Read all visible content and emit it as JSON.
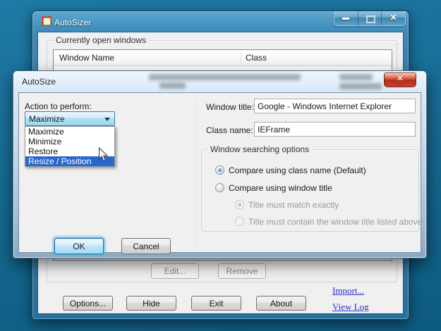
{
  "colors": {
    "desktop_top": "#1e7aa6",
    "desktop_bottom": "#0d5a80",
    "titlebar_blue": "#2e7dab",
    "selection_blue": "#2767ce",
    "close_button_red": "#c4452c",
    "link_blue": "#2430cf"
  },
  "main_window": {
    "title": "AutoSizer",
    "caption_buttons": [
      "minimize",
      "maximize",
      "close"
    ],
    "close_glyph": "✕",
    "open_windows_group": {
      "label": "Currently open windows",
      "columns": [
        "Window Name",
        "Class"
      ]
    },
    "edit_button": "Edit...",
    "remove_button": "Remove",
    "options_button": "Options...",
    "hide_button": "Hide",
    "exit_button": "Exit",
    "about_button": "About",
    "import_link": "Import...",
    "view_log_link": "View Log"
  },
  "dialog": {
    "title": "AutoSize",
    "close_glyph": "✕",
    "action_label": "Action to perform:",
    "action_value": "Maximize",
    "dropdown": {
      "items": [
        "Maximize",
        "Minimize",
        "Restore",
        "Resize / Position"
      ],
      "highlighted": "Resize / Position"
    },
    "window_title_label": "Window title:",
    "window_title_value": "Google - Windows Internet Explorer",
    "class_name_label": "Class name:",
    "class_name_value": "IEFrame",
    "search_group": {
      "label": "Window searching options",
      "options": [
        {
          "label": "Compare using class name (Default)",
          "selected": true,
          "disabled": false
        },
        {
          "label": "Compare using window title",
          "selected": false,
          "disabled": false
        },
        {
          "label": "Title must match exactly",
          "selected": true,
          "disabled": true
        },
        {
          "label": "Title must contain the window title listed above",
          "selected": false,
          "disabled": true
        }
      ]
    },
    "ok_button": "OK",
    "cancel_button": "Cancel"
  }
}
